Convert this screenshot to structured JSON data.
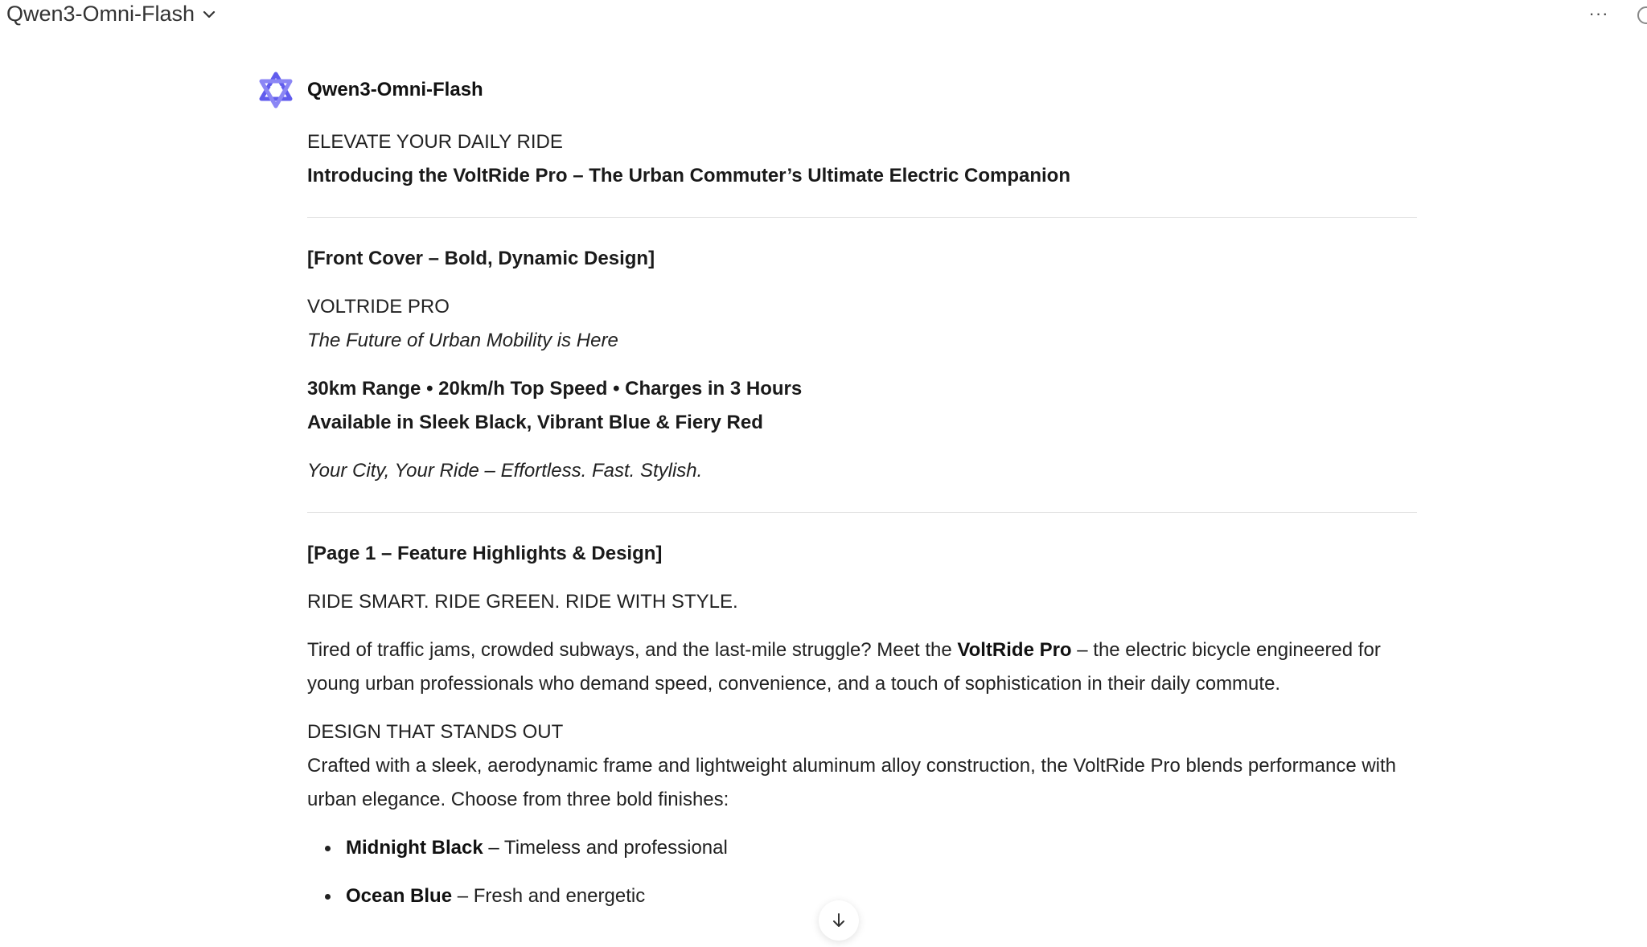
{
  "topbar": {
    "model_name": "Qwen3-Omni-Flash",
    "more_label": "···"
  },
  "message": {
    "sender": "Qwen3-Omni-Flash",
    "headline": "ELEVATE YOUR DAILY RIDE",
    "intro": "Introducing the VoltRide Pro – The Urban Commuter’s Ultimate Electric Companion",
    "cover": {
      "label": "[Front Cover – Bold, Dynamic Design]",
      "title": "VOLTRIDE PRO",
      "tagline": "The Future of Urban Mobility is Here",
      "specs": "30km Range • 20km/h Top Speed • Charges in 3 Hours",
      "colors": "Available in Sleek Black, Vibrant Blue & Fiery Red",
      "slogan": "Your City, Your Ride – Effortless. Fast. Stylish."
    },
    "page1": {
      "label": "[Page 1 – Feature Highlights & Design]",
      "heading": "RIDE SMART. RIDE GREEN. RIDE WITH STYLE.",
      "para_pre": "Tired of traffic jams, crowded subways, and the last-mile struggle? Meet the ",
      "para_bold": "VoltRide Pro",
      "para_post": " – the electric bicycle engineered for young urban professionals who demand speed, convenience, and a touch of sophistication in their daily commute.",
      "design_heading": "DESIGN THAT STANDS OUT",
      "design_text": "Crafted with a sleek, aerodynamic frame and lightweight aluminum alloy construction, the VoltRide Pro blends performance with urban elegance. Choose from three bold finishes:",
      "finishes": [
        {
          "name": "Midnight Black",
          "desc": " – Timeless and professional"
        },
        {
          "name": "Ocean Blue",
          "desc": " – Fresh and energetic"
        }
      ]
    }
  },
  "colors": {
    "brand": "#615ced",
    "text": "#222222",
    "divider": "#e5e5e5"
  },
  "icons": {
    "model_dropdown": "chevron-down-icon",
    "avatar": "qwen-logo-icon",
    "scroll": "arrow-down-icon"
  }
}
